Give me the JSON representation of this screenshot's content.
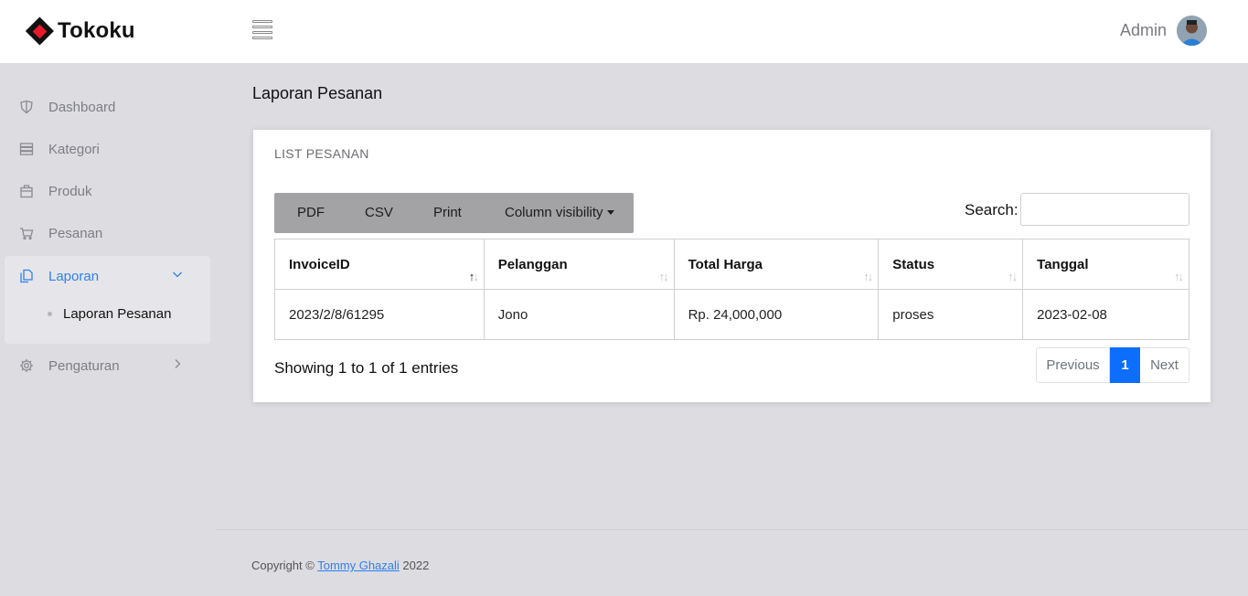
{
  "header": {
    "brand": "Tokoku",
    "user_name": "Admin"
  },
  "sidebar": {
    "items": [
      {
        "label": "Dashboard",
        "icon": "shield-icon"
      },
      {
        "label": "Kategori",
        "icon": "server-icon"
      },
      {
        "label": "Produk",
        "icon": "briefcase-icon"
      },
      {
        "label": "Pesanan",
        "icon": "cart-icon"
      },
      {
        "label": "Laporan",
        "icon": "files-icon",
        "active": true,
        "expanded": true
      },
      {
        "label": "Pengaturan",
        "icon": "gear-icon"
      }
    ],
    "sub_items": [
      {
        "label": "Laporan Pesanan"
      }
    ]
  },
  "page": {
    "title": "Laporan Pesanan"
  },
  "card": {
    "title": "LIST PESANAN",
    "buttons": {
      "pdf": "PDF",
      "csv": "CSV",
      "print": "Print",
      "colvis": "Column visibility"
    },
    "search_label": "Search:",
    "search_value": ""
  },
  "table": {
    "columns": [
      "InvoiceID",
      "Pelanggan",
      "Total Harga",
      "Status",
      "Tanggal"
    ],
    "rows": [
      [
        "2023/2/8/61295",
        "Jono",
        "Rp. 24,000,000",
        "proses",
        "2023-02-08"
      ]
    ]
  },
  "pagination": {
    "info": "Showing 1 to 1 of 1 entries",
    "previous": "Previous",
    "current": "1",
    "next": "Next"
  },
  "footer": {
    "prefix": "Copyright ©",
    "author": "Tommy Ghazali",
    "year": "2022"
  },
  "colors": {
    "accent": "#2f80ed",
    "page_active": "#0d6efd",
    "logo_red": "#e8192c",
    "background": "#dcdce1"
  }
}
